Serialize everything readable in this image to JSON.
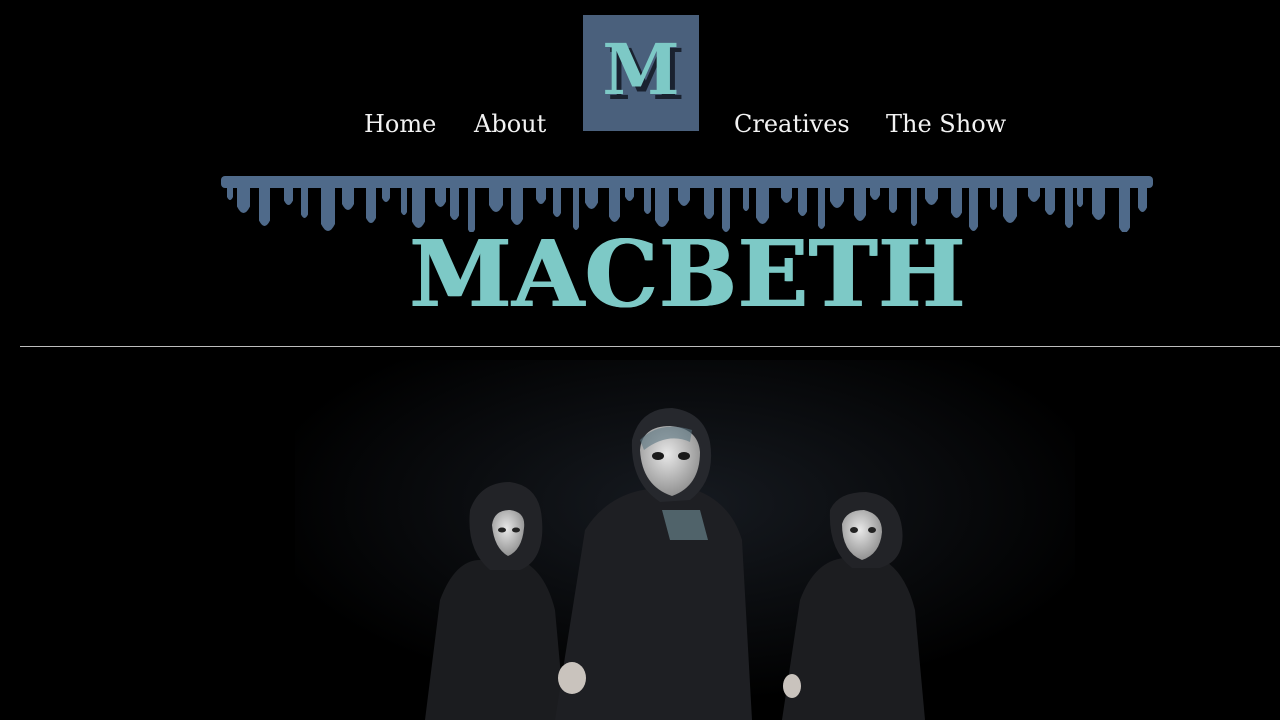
{
  "nav": {
    "items": [
      {
        "label": "Home"
      },
      {
        "label": "About"
      },
      {
        "label": "Creatives"
      },
      {
        "label": "The Show"
      }
    ]
  },
  "logo": {
    "letter": "M",
    "background": "#4a607c",
    "accent": "#7dc9c6"
  },
  "banner": {
    "title": "MACBETH",
    "drip_color": "#4f6a8a"
  },
  "hero": {
    "image": "three masked robed figures on stage"
  },
  "colors": {
    "background": "#000000",
    "text": "#f2f2f2",
    "accent": "#7dc9c6"
  }
}
